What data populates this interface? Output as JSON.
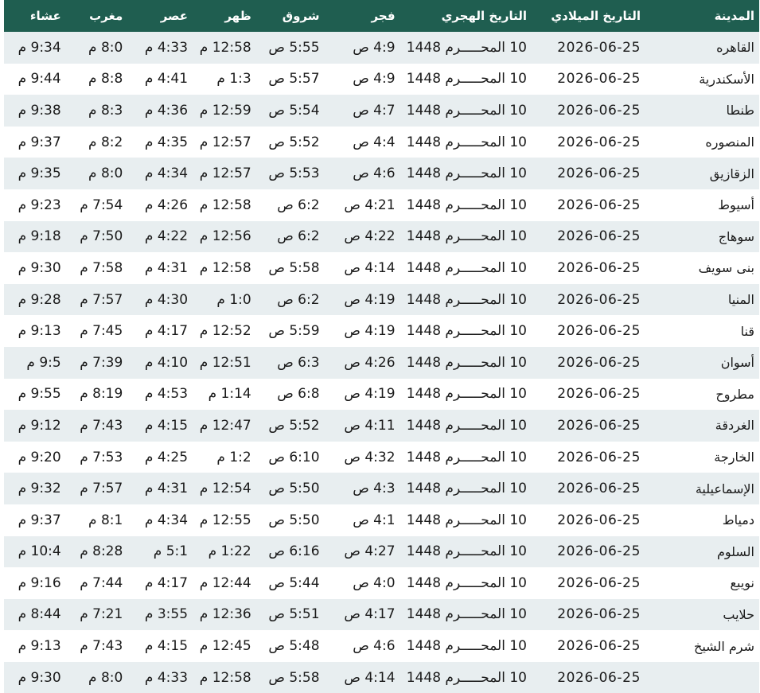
{
  "headers": [
    "المدينة",
    "التاريخ الميلادي",
    "التاريخ الهجري",
    "فجر",
    "شروق",
    "ظهر",
    "عصر",
    "مغرب",
    "عشاء"
  ],
  "rows": [
    [
      "القاهره",
      "2026-06-25",
      "10 المحـــــرم 1448",
      "4:9 ص",
      "5:55 ص",
      "12:58 م",
      "4:33 م",
      "8:0 م",
      "9:34 م"
    ],
    [
      "الأسكندرية",
      "2026-06-25",
      "10 المحـــــرم 1448",
      "4:9 ص",
      "5:57 ص",
      "1:3 م",
      "4:41 م",
      "8:8 م",
      "9:44 م"
    ],
    [
      "طنطا",
      "2026-06-25",
      "10 المحـــــرم 1448",
      "4:7 ص",
      "5:54 ص",
      "12:59 م",
      "4:36 م",
      "8:3 م",
      "9:38 م"
    ],
    [
      "المنصوره",
      "2026-06-25",
      "10 المحـــــرم 1448",
      "4:4 ص",
      "5:52 ص",
      "12:57 م",
      "4:35 م",
      "8:2 م",
      "9:37 م"
    ],
    [
      "الزقازيق",
      "2026-06-25",
      "10 المحـــــرم 1448",
      "4:6 ص",
      "5:53 ص",
      "12:57 م",
      "4:34 م",
      "8:0 م",
      "9:35 م"
    ],
    [
      "أسيوط",
      "2026-06-25",
      "10 المحـــــرم 1448",
      "4:21 ص",
      "6:2 ص",
      "12:58 م",
      "4:26 م",
      "7:54 م",
      "9:23 م"
    ],
    [
      "سوهاج",
      "2026-06-25",
      "10 المحـــــرم 1448",
      "4:22 ص",
      "6:2 ص",
      "12:56 م",
      "4:22 م",
      "7:50 م",
      "9:18 م"
    ],
    [
      "بنى سويف",
      "2026-06-25",
      "10 المحـــــرم 1448",
      "4:14 ص",
      "5:58 ص",
      "12:58 م",
      "4:31 م",
      "7:58 م",
      "9:30 م"
    ],
    [
      "المنيا",
      "2026-06-25",
      "10 المحـــــرم 1448",
      "4:19 ص",
      "6:2 ص",
      "1:0 م",
      "4:30 م",
      "7:57 م",
      "9:28 م"
    ],
    [
      "قنا",
      "2026-06-25",
      "10 المحـــــرم 1448",
      "4:19 ص",
      "5:59 ص",
      "12:52 م",
      "4:17 م",
      "7:45 م",
      "9:13 م"
    ],
    [
      "أسوان",
      "2026-06-25",
      "10 المحـــــرم 1448",
      "4:26 ص",
      "6:3 ص",
      "12:51 م",
      "4:10 م",
      "7:39 م",
      "9:5 م"
    ],
    [
      "مطروح",
      "2026-06-25",
      "10 المحـــــرم 1448",
      "4:19 ص",
      "6:8 ص",
      "1:14 م",
      "4:53 م",
      "8:19 م",
      "9:55 م"
    ],
    [
      "الغردقة",
      "2026-06-25",
      "10 المحـــــرم 1448",
      "4:11 ص",
      "5:52 ص",
      "12:47 م",
      "4:15 م",
      "7:43 م",
      "9:12 م"
    ],
    [
      "الخارجة",
      "2026-06-25",
      "10 المحـــــرم 1448",
      "4:32 ص",
      "6:10 ص",
      "1:2 م",
      "4:25 م",
      "7:53 م",
      "9:20 م"
    ],
    [
      "الإسماعيلية",
      "2026-06-25",
      "10 المحـــــرم 1448",
      "4:3 ص",
      "5:50 ص",
      "12:54 م",
      "4:31 م",
      "7:57 م",
      "9:32 م"
    ],
    [
      "دمياط",
      "2026-06-25",
      "10 المحـــــرم 1448",
      "4:1 ص",
      "5:50 ص",
      "12:55 م",
      "4:34 م",
      "8:1 م",
      "9:37 م"
    ],
    [
      "السلوم",
      "2026-06-25",
      "10 المحـــــرم 1448",
      "4:27 ص",
      "6:16 ص",
      "1:22 م",
      "5:1 م",
      "8:28 م",
      "10:4 م"
    ],
    [
      "نويبع",
      "2026-06-25",
      "10 المحـــــرم 1448",
      "4:0 ص",
      "5:44 ص",
      "12:44 م",
      "4:17 م",
      "7:44 م",
      "9:16 م"
    ],
    [
      "حلايب",
      "2026-06-25",
      "10 المحـــــرم 1448",
      "4:17 ص",
      "5:51 ص",
      "12:36 م",
      "3:55 م",
      "7:21 م",
      "8:44 م"
    ],
    [
      "شرم الشيخ",
      "2026-06-25",
      "10 المحـــــرم 1448",
      "4:6 ص",
      "5:48 ص",
      "12:45 م",
      "4:15 م",
      "7:43 م",
      "9:13 م"
    ],
    [
      "",
      "2026-06-25",
      "10 المحـــــرم 1448",
      "4:14 ص",
      "5:58 ص",
      "12:58 م",
      "4:33 م",
      "8:0 م",
      "9:30 م"
    ]
  ],
  "colors": {
    "header_bg": "#1f5e50",
    "row_alt": "#e8eef0"
  }
}
